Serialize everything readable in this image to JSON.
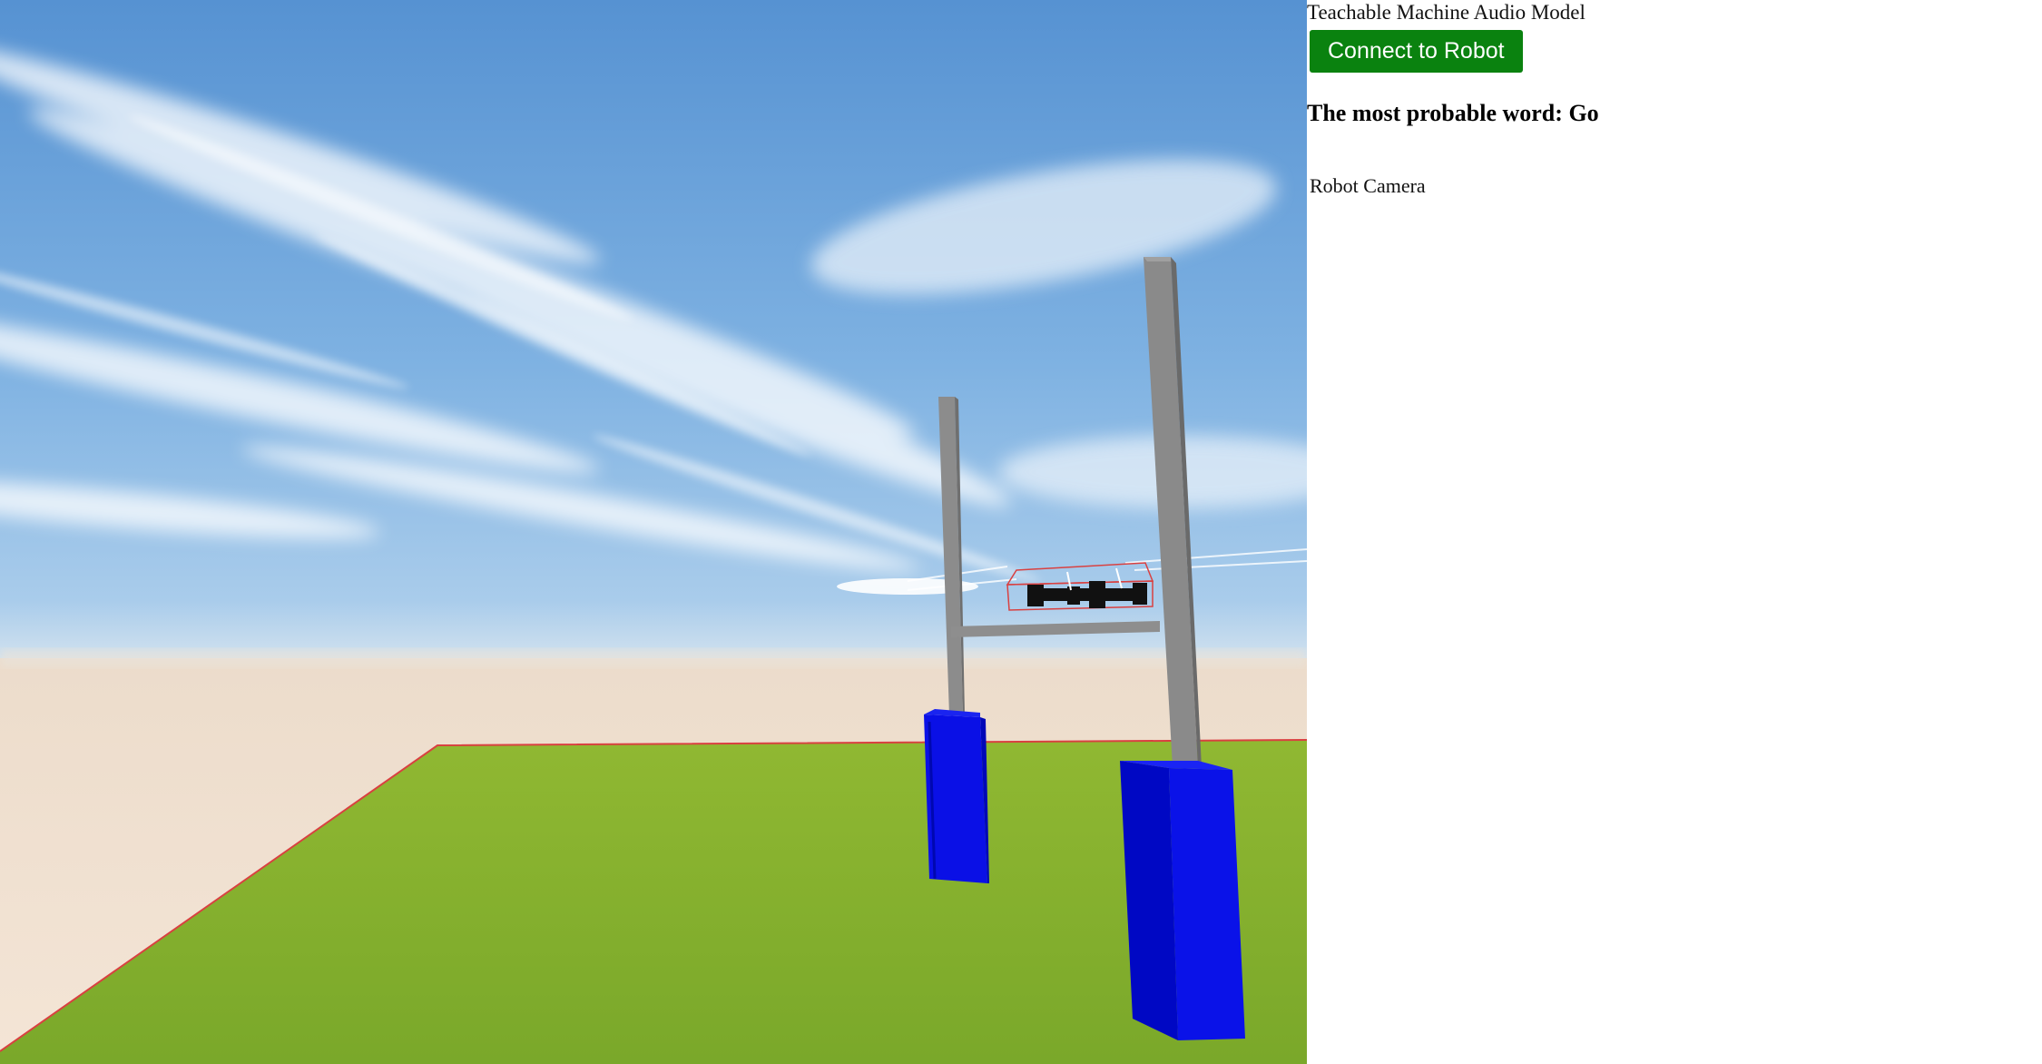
{
  "panel": {
    "model_title": "Teachable Machine Audio Model",
    "connect_button_label": "Connect to Robot",
    "prediction_label": "The most probable word:",
    "prediction_word": "Go",
    "camera_label": "Robot Camera"
  },
  "scene": {
    "colors": {
      "sky_top": "#5a9ad6",
      "sky_horizon": "#bcd6ec",
      "ground_far": "#efe2d3",
      "grass": "#8db531",
      "pillar_blue": "#0a14e0",
      "post_gray": "#8a8a8a",
      "boundary_red": "#d94040"
    }
  }
}
